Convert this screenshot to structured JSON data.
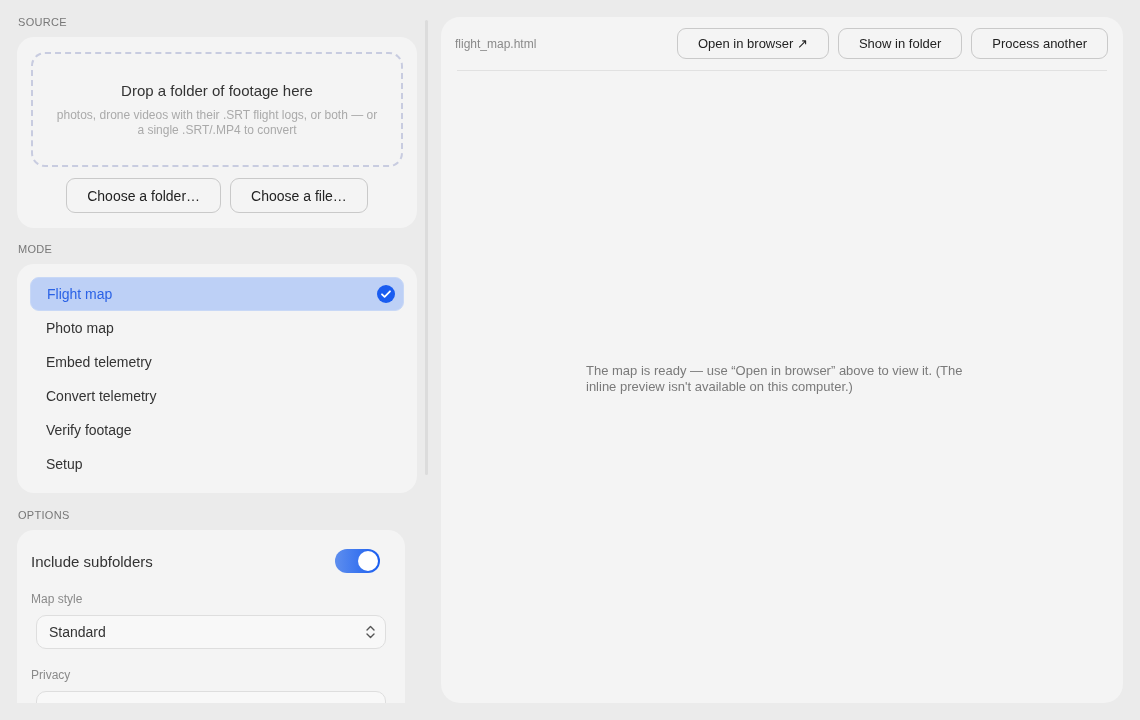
{
  "source": {
    "section_label": "SOURCE",
    "drop_title": "Drop a folder of footage here",
    "drop_hint": "photos, drone videos with their .SRT flight logs, or both — or a single .SRT/.MP4 to convert",
    "buttons": [
      "Choose a folder…",
      "Choose a file…"
    ]
  },
  "mode": {
    "section_label": "MODE",
    "items": [
      {
        "label": "Flight map",
        "selected": true
      },
      {
        "label": "Photo map",
        "selected": false
      },
      {
        "label": "Embed telemetry",
        "selected": false
      },
      {
        "label": "Convert telemetry",
        "selected": false
      },
      {
        "label": "Verify footage",
        "selected": false
      },
      {
        "label": "Setup",
        "selected": false
      }
    ]
  },
  "options": {
    "section_label": "OPTIONS",
    "include_subfolders": {
      "label": "Include subfolders",
      "on": true
    },
    "map_style": {
      "label": "Map style",
      "value": "Standard"
    },
    "privacy": {
      "label": "Privacy"
    }
  },
  "preview": {
    "file_name": "flight_map.html",
    "buttons": [
      "Open in browser ↗",
      "Show in folder",
      "Process another"
    ],
    "message": "The map is ready — use “Open in browser” above to view it. (The inline preview isn't available on this computer.)"
  }
}
